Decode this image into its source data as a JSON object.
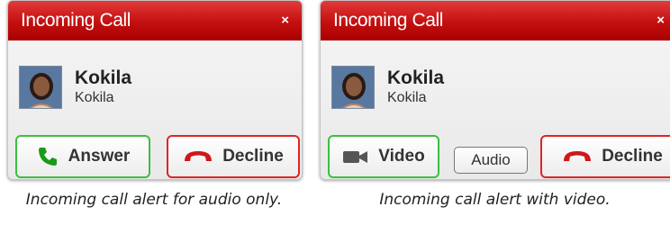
{
  "audio_alert": {
    "title": "Incoming Call",
    "close_symbol": "×",
    "caller_name": "Kokila",
    "caller_sub": "Kokila",
    "answer_label": "Answer",
    "decline_label": "Decline",
    "caption": "Incoming call alert for audio only."
  },
  "video_alert": {
    "title": "Incoming Call",
    "close_symbol": "×",
    "caller_name": "Kokila",
    "caller_sub": "Kokila",
    "video_label": "Video",
    "audio_label": "Audio",
    "decline_label": "Decline",
    "caption": "Incoming call alert with video."
  },
  "icons": {
    "answer": "phone-handset-icon",
    "decline": "hang-up-icon",
    "video": "video-camera-icon",
    "close": "close-icon"
  },
  "colors": {
    "titlebar": "#c30f0f",
    "answer_border": "#3cc03c",
    "decline_border": "#e02424",
    "answer_icon": "#1a9a1a",
    "decline_icon": "#d01818"
  }
}
